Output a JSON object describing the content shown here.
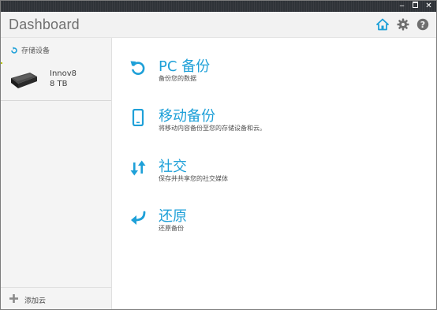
{
  "window_controls": {
    "minimize": "‒",
    "close": "✕"
  },
  "header": {
    "title": "Dashboard",
    "icons": [
      "home-icon",
      "gear-icon",
      "help-icon"
    ]
  },
  "sidebar": {
    "storage_heading": "存储设备",
    "device": {
      "name": "Innov8",
      "size": "8 TB"
    },
    "add_cloud": "添加云"
  },
  "actions": [
    {
      "title": "PC 备份",
      "description": "备份您的数据",
      "icon": "backup-restore-arrow-icon"
    },
    {
      "title": "移动备份",
      "description": "将移动内容备份至您的存储设备和云。",
      "icon": "mobile-phone-icon"
    },
    {
      "title": "社交",
      "description": "保存并共享您的社交媒体",
      "icon": "up-down-arrows-icon"
    },
    {
      "title": "还原",
      "description": "还原备份",
      "icon": "return-arrow-icon"
    }
  ],
  "colors": {
    "accent": "#1ea0d8",
    "titlebar": "#2f3338",
    "sidebar": "#f4f4f4"
  }
}
